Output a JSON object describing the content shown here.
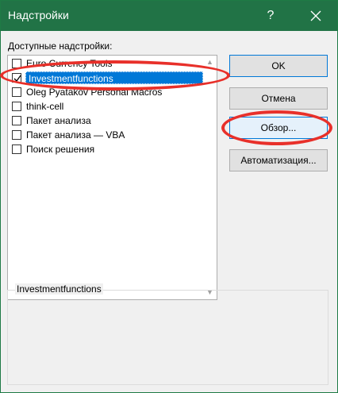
{
  "window": {
    "title": "Надстройки"
  },
  "titlebar": {
    "help_label": "?"
  },
  "addins": {
    "label": "Доступные надстройки:",
    "items": [
      {
        "label": "Euro Currency Tools",
        "checked": false,
        "selected": false
      },
      {
        "label": "Investmentfunctions",
        "checked": true,
        "selected": true
      },
      {
        "label": "Oleg Pyatakov Personal Macros",
        "checked": false,
        "selected": false
      },
      {
        "label": "think-cell",
        "checked": false,
        "selected": false
      },
      {
        "label": "Пакет анализа",
        "checked": false,
        "selected": false
      },
      {
        "label": "Пакет анализа — VBA",
        "checked": false,
        "selected": false
      },
      {
        "label": "Поиск решения",
        "checked": false,
        "selected": false
      }
    ]
  },
  "buttons": {
    "ok": "OK",
    "cancel": "Отмена",
    "browse": "Обзор...",
    "automation": "Автоматизация..."
  },
  "description": {
    "title": "Investmentfunctions"
  },
  "colors": {
    "titlebar": "#217346",
    "selection": "#0078d7",
    "annotation": "#e8302a"
  }
}
